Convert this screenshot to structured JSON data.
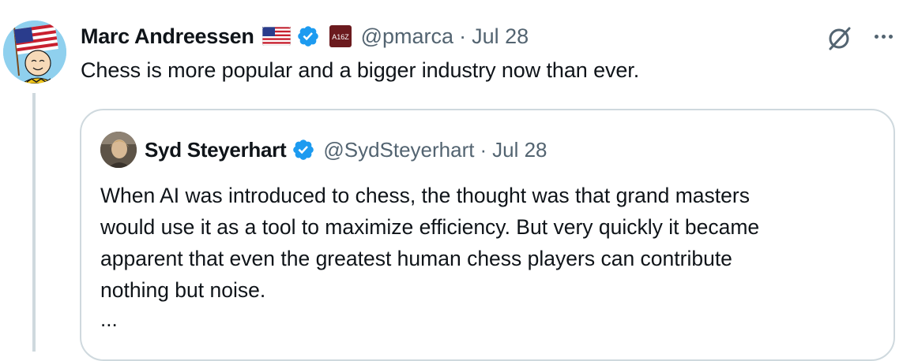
{
  "post": {
    "author_name": "Marc Andreessen",
    "handle": "@pmarca",
    "separator": "·",
    "date": "Jul 28",
    "text": "Chess is more popular and a bigger industry now than ever.",
    "icons": {
      "flag": "us-flag-icon",
      "verified": "verified-badge-icon",
      "affiliation": "a16z-affiliation-icon",
      "grok": "grok-icon",
      "more": "more-options-icon"
    }
  },
  "quoted_post": {
    "author_name": "Syd Steyerhart",
    "handle": "@SydSteyerhart",
    "separator": "·",
    "date": "Jul 28",
    "lines": [
      "When AI was introduced to chess, the thought was that grand masters",
      "would use it as a tool to maximize efficiency. But very quickly it became",
      "apparent that even the greatest human chess players can contribute",
      "nothing but noise."
    ],
    "truncation": "..."
  },
  "colors": {
    "text_primary": "#0f1419",
    "text_secondary": "#536471",
    "verified_blue": "#1d9bf0",
    "border": "#cfd9de"
  }
}
